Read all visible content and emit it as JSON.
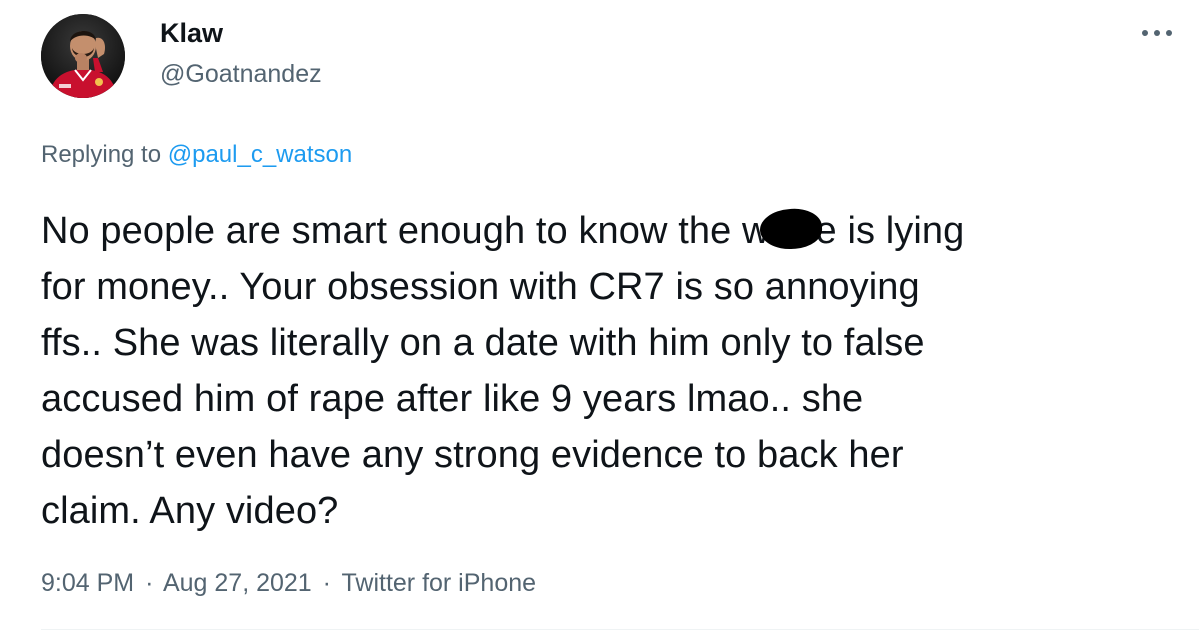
{
  "author": {
    "display_name": "Klaw",
    "handle": "@Goatnandez",
    "avatar_icon": "profile-photo"
  },
  "more_icon": "ellipsis-icon",
  "reply": {
    "prefix": "Replying to ",
    "mention": "@paul_c_watson"
  },
  "tweet": {
    "lines": [
      {
        "before": "No people are smart enough to know the w",
        "after": "e is lying"
      },
      "for money.. Your obsession with CR7 is so annoying",
      "ffs.. She was literally on a date with him only to false",
      "accused him of rape after like 9 years lmao.. she",
      "doesn’t even have any strong evidence to back her",
      "claim. Any video?"
    ]
  },
  "meta": {
    "time": "9:04 PM",
    "separator": "·",
    "date": "Aug 27, 2021",
    "source": "Twitter for iPhone"
  },
  "colors": {
    "text": "#0f1419",
    "secondary": "#536471",
    "link": "#1d9bf0",
    "kit_red": "#c8102e"
  }
}
